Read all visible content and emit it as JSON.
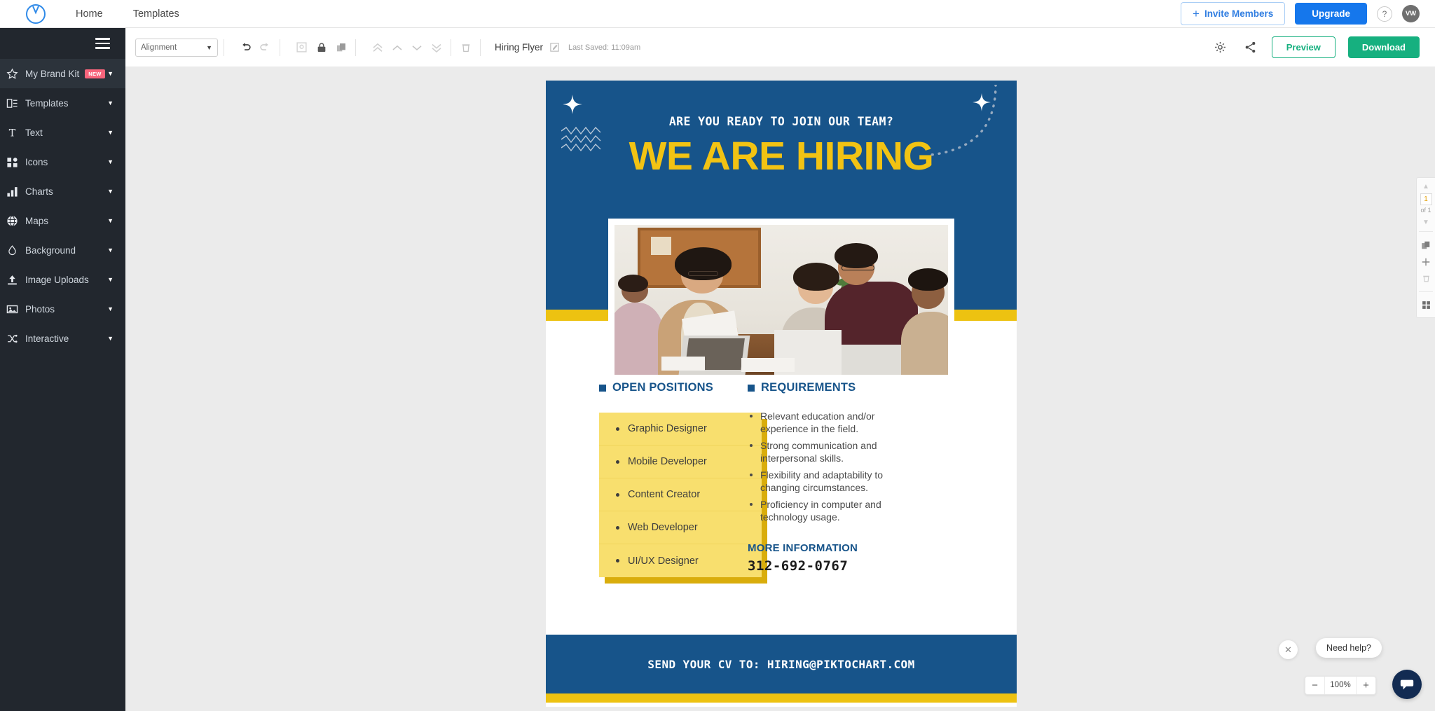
{
  "topnav": {
    "logo_icon": "piktochart-logo-icon",
    "links": [
      {
        "label": "Home"
      },
      {
        "label": "Templates"
      }
    ],
    "invite_label": "Invite Members",
    "invite_plus": "+",
    "upgrade_label": "Upgrade",
    "help_label": "?",
    "avatar_initials": "VW"
  },
  "sidebar": {
    "menu_icon": "hamburger-menu-icon",
    "items": [
      {
        "label": "My Brand Kit",
        "icon": "star-icon",
        "badge": "NEW",
        "active": true
      },
      {
        "label": "Templates",
        "icon": "templates-icon",
        "badge": "",
        "active": false
      },
      {
        "label": "Text",
        "icon": "text-t-icon",
        "badge": "",
        "active": false
      },
      {
        "label": "Icons",
        "icon": "icons-grid-icon",
        "badge": "",
        "active": false
      },
      {
        "label": "Charts",
        "icon": "bar-chart-icon",
        "badge": "",
        "active": false
      },
      {
        "label": "Maps",
        "icon": "globe-icon",
        "badge": "",
        "active": false
      },
      {
        "label": "Background",
        "icon": "droplet-icon",
        "badge": "",
        "active": false
      },
      {
        "label": "Image Uploads",
        "icon": "upload-icon",
        "badge": "",
        "active": false
      },
      {
        "label": "Photos",
        "icon": "photo-icon",
        "badge": "",
        "active": false
      },
      {
        "label": "Interactive",
        "icon": "interactive-icon",
        "badge": "",
        "active": false
      }
    ]
  },
  "toolbar": {
    "alignment_value": "Alignment",
    "icons": [
      "undo-icon",
      "redo-icon",
      "crop-icon",
      "lock-icon",
      "duplicate-icon",
      "bring-to-front-icon",
      "bring-forward-icon",
      "send-backward-icon",
      "send-to-back-icon",
      "delete-icon"
    ],
    "doc_title": "Hiring Flyer",
    "edit_icon": "edit-pencil-icon",
    "last_saved": "Last Saved: 11:09am",
    "settings_icon": "gear-icon",
    "share_icon": "share-icon",
    "preview_label": "Preview",
    "download_label": "Download"
  },
  "flyer": {
    "kicker": "ARE YOU READY TO JOIN OUR TEAM?",
    "title": "WE ARE HIRING",
    "photo_alt": "office-team-meeting-photo",
    "open_positions": {
      "heading": "OPEN POSITIONS",
      "items": [
        "Graphic Designer",
        "Mobile Developer",
        "Content Creator",
        "Web Developer",
        "UI/UX Designer"
      ]
    },
    "requirements": {
      "heading": "REQUIREMENTS",
      "items": [
        "Relevant education and/or experience in the field.",
        "Strong communication and interpersonal skills.",
        "Flexibility and adaptability to changing circumstances.",
        "Proficiency in computer and technology usage."
      ]
    },
    "more_information_label": "MORE INFORMATION",
    "phone": "312-692-0767",
    "footer_text": "SEND YOUR CV TO: HIRING@PIKTOCHART.COM",
    "colors": {
      "blue": "#17548a",
      "yellow": "#edc211",
      "card_yellow": "#f8df6e",
      "card_shadow": "#d9ad0c",
      "title_yellow": "#f2c313"
    }
  },
  "page_panel": {
    "up_arrow": "▲",
    "page_number": "1",
    "page_of": "of 1",
    "down_arrow": "▼",
    "duplicate_icon": "duplicate-page-icon",
    "add_icon": "add-page-icon",
    "delete_icon": "delete-page-icon",
    "grid_icon": "page-grid-icon"
  },
  "footer_controls": {
    "zoom_out": "−",
    "zoom_value": "100%",
    "zoom_in": "+",
    "need_help_label": "Need help?",
    "close_label": "✕",
    "chat_icon": "chat-bubble-icon"
  }
}
